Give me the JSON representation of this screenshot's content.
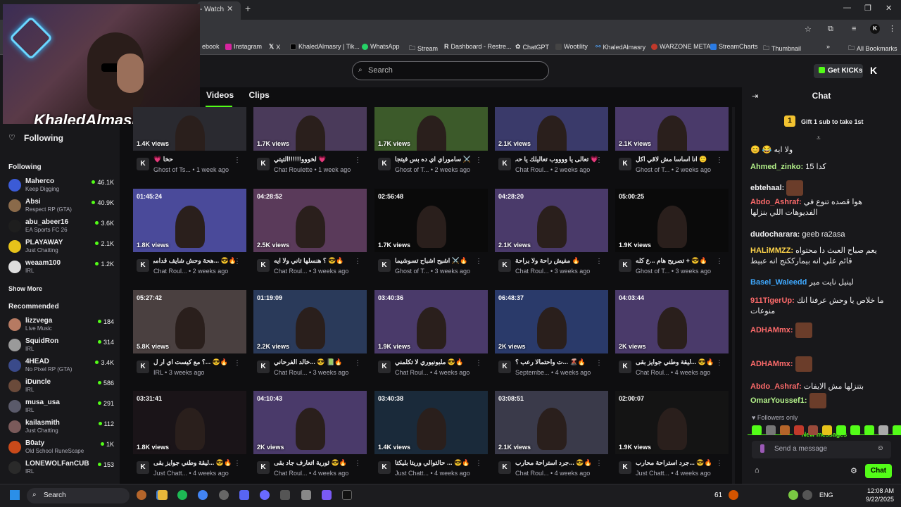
{
  "browser": {
    "tab_title": "- Watch",
    "bookmarks": [
      "ebook",
      "Instagram",
      "X",
      "KhaledAlmasry | Tik...",
      "WhatsApp",
      "Stream",
      "Dashboard - Restre...",
      "ChatGPT",
      "Wootility",
      "KhaledAlmasry",
      "WARZONE META",
      "StreamCharts",
      "Thumbnail"
    ],
    "all_bookmarks": "All Bookmarks"
  },
  "header": {
    "search_placeholder": "Search",
    "get_kicks": "Get KICKs"
  },
  "facecam": {
    "streamer_name": "KhaledAlmasry"
  },
  "sidebar": {
    "following_label": "Following",
    "following_section": "Following",
    "show_more": "Show More",
    "recommended_section": "Recommended",
    "following_channels": [
      {
        "name": "Maherco",
        "category": "Keep Digging",
        "viewers": "46.1K",
        "color": "#3b5bd6"
      },
      {
        "name": "Absi",
        "category": "Respect RP (GTA)",
        "viewers": "40.9K",
        "color": "#8a6a4a"
      },
      {
        "name": "abu_abeer16",
        "category": "EA Sports FC 26",
        "viewers": "3.6K",
        "color": "#1e1e1e"
      },
      {
        "name": "PLAYAWAY",
        "category": "Just Chatting",
        "viewers": "2.1K",
        "color": "#e6c21a"
      },
      {
        "name": "weaam100",
        "category": "IRL",
        "viewers": "1.2K",
        "color": "#ddd"
      }
    ],
    "recommended_channels": [
      {
        "name": "lizzvega",
        "category": "Live Music",
        "viewers": "184",
        "color": "#b67a62"
      },
      {
        "name": "SquidRon",
        "category": "IRL",
        "viewers": "314",
        "color": "#9a9a9a"
      },
      {
        "name": "4HEAD",
        "category": "No Pixel RP (GTA)",
        "viewers": "3.4K",
        "color": "#3a4a8a"
      },
      {
        "name": "iDuncle",
        "category": "IRL",
        "viewers": "586",
        "color": "#6a4a3a"
      },
      {
        "name": "musa_usa",
        "category": "IRL",
        "viewers": "291",
        "color": "#5a5a6a"
      },
      {
        "name": "kailasmith",
        "category": "Just Chatting",
        "viewers": "112",
        "color": "#7a5a5a"
      },
      {
        "name": "B0aty",
        "category": "Old School RuneScape",
        "viewers": "1K",
        "color": "#c94a1a"
      },
      {
        "name": "LONEWOLFanCUB",
        "category": "IRL",
        "viewers": "153",
        "color": "#2a2a2a"
      }
    ]
  },
  "main": {
    "tab_videos": "Videos",
    "tab_clips": "Clips",
    "videos": [
      {
        "duration": "",
        "views": "1.4K views",
        "title": "حخا 💗",
        "meta": "Ghost of Ts... • 1 week ago",
        "bg": "#2a2a30"
      },
      {
        "duration": "",
        "views": "1.7K views",
        "title": "💗 لخووو!!!!!!التيتي",
        "meta": "Chat Roulette • 1 week ago",
        "bg": "#4a3a5a"
      },
      {
        "duration": "",
        "views": "1.7K views",
        "title": "⚔️ ساموراي اي ده بس فيتجا",
        "meta": "Ghost of T... • 2 weeks ago",
        "bg": "#3c5a2a"
      },
      {
        "duration": "",
        "views": "2.1K views",
        "title": "💗 تعالى يا ووووب تعاليلك يا حب",
        "meta": "Chat Roul... • 2 weeks ago",
        "bg": "#3a3a6a"
      },
      {
        "duration": "",
        "views": "2.1K views",
        "title": "🙂 انا اساسا مش لاقي اكل",
        "meta": "Ghost of T... • 2 weeks ago",
        "bg": "#4a3a6a"
      },
      {
        "duration": "01:45:24",
        "views": "1.8K views",
        "title": "🔥😎 ...هحة وحش شايف قدامي",
        "meta": "Chat Roul... • 2 weeks ago",
        "bg": "#4a4a9a"
      },
      {
        "duration": "04:28:52",
        "views": "2.5K views",
        "title": "🔥😎 ؟ هنسلها تاني ولا ايه",
        "meta": "Chat Roul... • 3 weeks ago",
        "bg": "#5a3a5a"
      },
      {
        "duration": "02:56:48",
        "views": "1.7K views",
        "title": "🔥⚔️ اشبح اشباح تسوشيما",
        "meta": "Ghost of T... • 3 weeks ago",
        "bg": "#0a0a0a"
      },
      {
        "duration": "04:28:20",
        "views": "2.1K views",
        "title": "🔥 مفيش راحة ولا براحة",
        "meta": "Chat Roul... • 3 weeks ago",
        "bg": "#4a3a6a"
      },
      {
        "duration": "05:00:25",
        "views": "1.9K views",
        "title": "🔥😎 + تصريح هام ...ع كله",
        "meta": "Ghost of T... • 3 weeks ago",
        "bg": "#0a0a0a"
      },
      {
        "duration": "05:27:42",
        "views": "5.8K views",
        "title": "🔥😎 ...؟ مع كيست اي ار ل",
        "meta": "IRL • 3 weeks ago",
        "bg": "#4a4040"
      },
      {
        "duration": "01:19:09",
        "views": "2.2K views",
        "title": "🔥📗 😎 ...خالد الفرحاني",
        "meta": "Chat Roul... • 3 weeks ago",
        "bg": "#2a3a5a"
      },
      {
        "duration": "03:40:36",
        "views": "1.9K views",
        "title": "🔥😎 ملبونيوري لا تكلمني",
        "meta": "Chat Roul... • 4 weeks ago",
        "bg": "#4a3a6a"
      },
      {
        "duration": "06:48:37",
        "views": "2K views",
        "title": "🔥🌋 ...ت واحتمالا رعب ؟",
        "meta": "Septembe... • 4 weeks ago",
        "bg": "#2a3a6a"
      },
      {
        "duration": "04:03:44",
        "views": "2K views",
        "title": "🔥😎 ...ليقة وطني جوايز بقى",
        "meta": "Chat Roul... • 4 weeks ago",
        "bg": "#4a3a6a"
      },
      {
        "duration": "03:31:41",
        "views": "1.8K views",
        "title": "🔥😎 ...ليقة وطني جوايز بقى",
        "meta": "Just Chatt... • 4 weeks ago",
        "bg": "#1a1418"
      },
      {
        "duration": "04:10:43",
        "views": "2K views",
        "title": "🔥😎 ثورية اتعارف جاد بقى",
        "meta": "Chat Roul... • 4 weeks ago",
        "bg": "#4a3a6a"
      },
      {
        "duration": "03:40:38",
        "views": "1.4K views",
        "title": "🔥😎 ... حالتوالي وريتا بليكتا",
        "meta": "Just Chatt... • 4 weeks ago",
        "bg": "#1a2a3a"
      },
      {
        "duration": "03:08:51",
        "views": "2.1K views",
        "title": "🔥😎 ...جرد استراحة محارب",
        "meta": "Chat Roul... • 4 weeks ago",
        "bg": "#3a3a4a"
      },
      {
        "duration": "02:00:07",
        "views": "1.9K views",
        "title": "🔥😎 ...جرد استراحة محارب",
        "meta": "Just Chatt... • 4 weeks ago",
        "bg": "#141414"
      }
    ]
  },
  "chat": {
    "title": "Chat",
    "gift_text": "Gift 1 sub to take 1st",
    "gift_rank": "1",
    "messages": [
      {
        "user": "",
        "text": "😊 😂 ولا ايه",
        "color": "#efeff1"
      },
      {
        "user": "Ahmed_zinko:",
        "text": "كدا 15",
        "color": "#b4f28a"
      },
      {
        "user": "ebtehaal:",
        "text": "",
        "color": "#efeff1",
        "emote": true
      },
      {
        "user": "Abdo_Ashraf:",
        "text": "هوا قصده تنوع في الفديوهات اللي بنزلها",
        "color": "#ff6b6b"
      },
      {
        "user": "dudocharara:",
        "text": "geeb ra2asa",
        "color": "#efeff1"
      },
      {
        "user": "HALiMMZZ:",
        "text": "يعم صباح العبث دا محتواه قائم علي انه بيمارككنج انه عبيط",
        "color": "#ffd54a"
      },
      {
        "user": "Basel_Waleedd",
        "text": "لينيل نايت مير",
        "color": "#3fa9ff"
      },
      {
        "user": "911TigerUp:",
        "text": "ما خلاص يا وحش عرفنا انك منوعات",
        "color": "#ff6b6b"
      },
      {
        "user": "ADHAMmx:",
        "text": "",
        "color": "#ff6b6b",
        "emote": true
      }
    ],
    "new_messages_label": "New messages",
    "new_messages": [
      {
        "user": "ADHAMmx:",
        "text": "",
        "color": "#ff6b6b",
        "emote": true
      },
      {
        "user": "Abdo_Ashraf:",
        "text": "بتنزلها مش الايفات",
        "color": "#ff6b6b"
      },
      {
        "user": "OmarYoussef1:",
        "text": "",
        "color": "#b4f28a",
        "emote": true
      }
    ],
    "followers_only": "Followers only",
    "input_placeholder": "Send a message",
    "send_button": "Chat"
  },
  "taskbar": {
    "search": "Search",
    "tray_number": "61",
    "lang": "ENG",
    "time": "12:08 AM",
    "date": "9/22/2025"
  }
}
